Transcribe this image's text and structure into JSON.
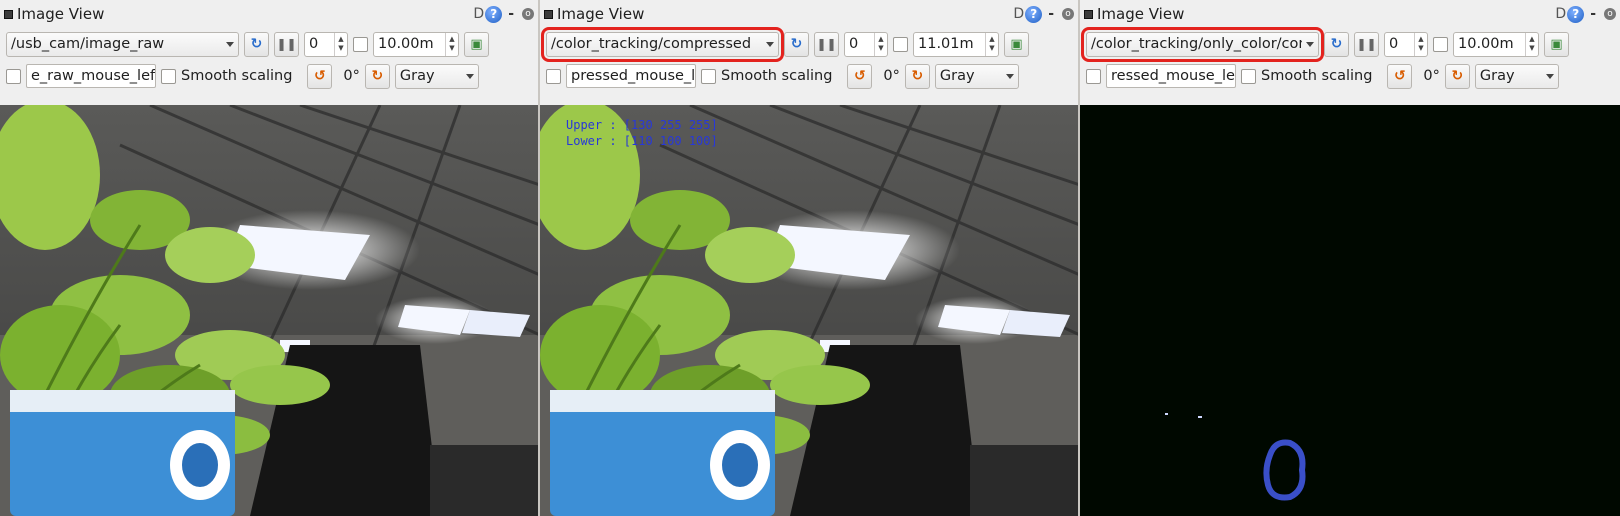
{
  "panels": [
    {
      "title": "Image View",
      "help_letter": "D",
      "help_q": "?",
      "dash": "-",
      "close": "o",
      "topic": "/usb_cam/image_raw",
      "spin_value": "0",
      "duration": "10.00m",
      "mouse_field": "e_raw_mouse_left",
      "smooth_label": "Smooth scaling",
      "rotation": "0°",
      "color_scheme": "Gray",
      "highlight": false,
      "view": "camera",
      "overlay": []
    },
    {
      "title": "Image View",
      "help_letter": "D",
      "help_q": "?",
      "dash": "-",
      "close": "o",
      "topic": "/color_tracking/compressed",
      "spin_value": "0",
      "duration": "11.01m",
      "mouse_field": "pressed_mouse_lef",
      "smooth_label": "Smooth scaling",
      "rotation": "0°",
      "color_scheme": "Gray",
      "highlight": true,
      "view": "camera",
      "overlay": [
        "Upper : [130 255 255]",
        "Lower : [110 100 100]"
      ]
    },
    {
      "title": "Image View",
      "help_letter": "D",
      "help_q": "?",
      "dash": "-",
      "close": "o",
      "topic": "/color_tracking/only_color/compr",
      "spin_value": "0",
      "duration": "10.00m",
      "mouse_field": "ressed_mouse_left",
      "smooth_label": "Smooth scaling",
      "rotation": "0°",
      "color_scheme": "Gray",
      "highlight": true,
      "view": "mask",
      "overlay": []
    }
  ],
  "colors": {
    "highlight_outline": "#e3231e",
    "overlay_text": "#2838d8",
    "mask_background": "#000800",
    "mask_blob": "#3a4fc8"
  }
}
